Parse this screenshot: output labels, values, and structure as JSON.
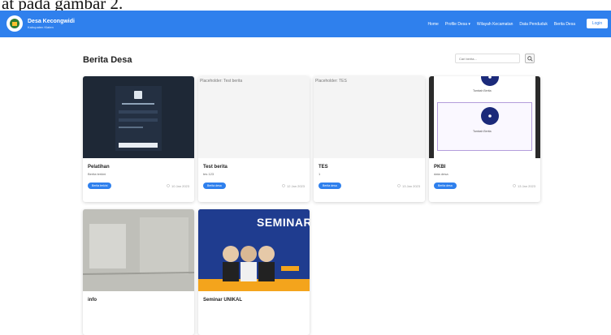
{
  "caption": "at pada gambar 2.",
  "navbar": {
    "brand_title": "Desa Kecongwidi",
    "brand_subtitle": "Kabupaten Klaten",
    "menu": [
      "Home",
      "Profile Desa ▾",
      "Wilayah Kecamatan",
      "Data Penduduk",
      "Berita Desa"
    ],
    "button_label": "Login"
  },
  "main": {
    "title": "Berita Desa",
    "search_placeholder": "Cari berita..."
  },
  "cards": [
    {
      "title": "Pelatihan",
      "subtitle": "Berita terkini",
      "badge": "Berita terkini",
      "date": "10 Jan 2023",
      "placeholder": ""
    },
    {
      "title": "Test berita",
      "subtitle": "tes 123",
      "badge": "Berita desa",
      "date": "12 Jan 2023",
      "placeholder": "Placeholder: Test berita"
    },
    {
      "title": "TES",
      "subtitle": "1",
      "badge": "Berita desa",
      "date": "13 Jan 2023",
      "placeholder": "Placeholder: TES"
    },
    {
      "title": "PKBI",
      "subtitle": "data desa",
      "badge": "Berita desa",
      "date": "13 Jan 2023",
      "placeholder": "",
      "stepper_labels": [
        "Tambah Berita",
        "Tambah Berita"
      ]
    },
    {
      "title": "info",
      "subtitle": "",
      "badge": "",
      "date": "",
      "placeholder": ""
    },
    {
      "title": "Seminar UNIKAL",
      "subtitle": "",
      "badge": "",
      "date": "",
      "placeholder": "",
      "poster_text": "SEMINAR"
    }
  ],
  "colors": {
    "primary": "#2f80ed",
    "dark_thumb": "#1e2836"
  }
}
